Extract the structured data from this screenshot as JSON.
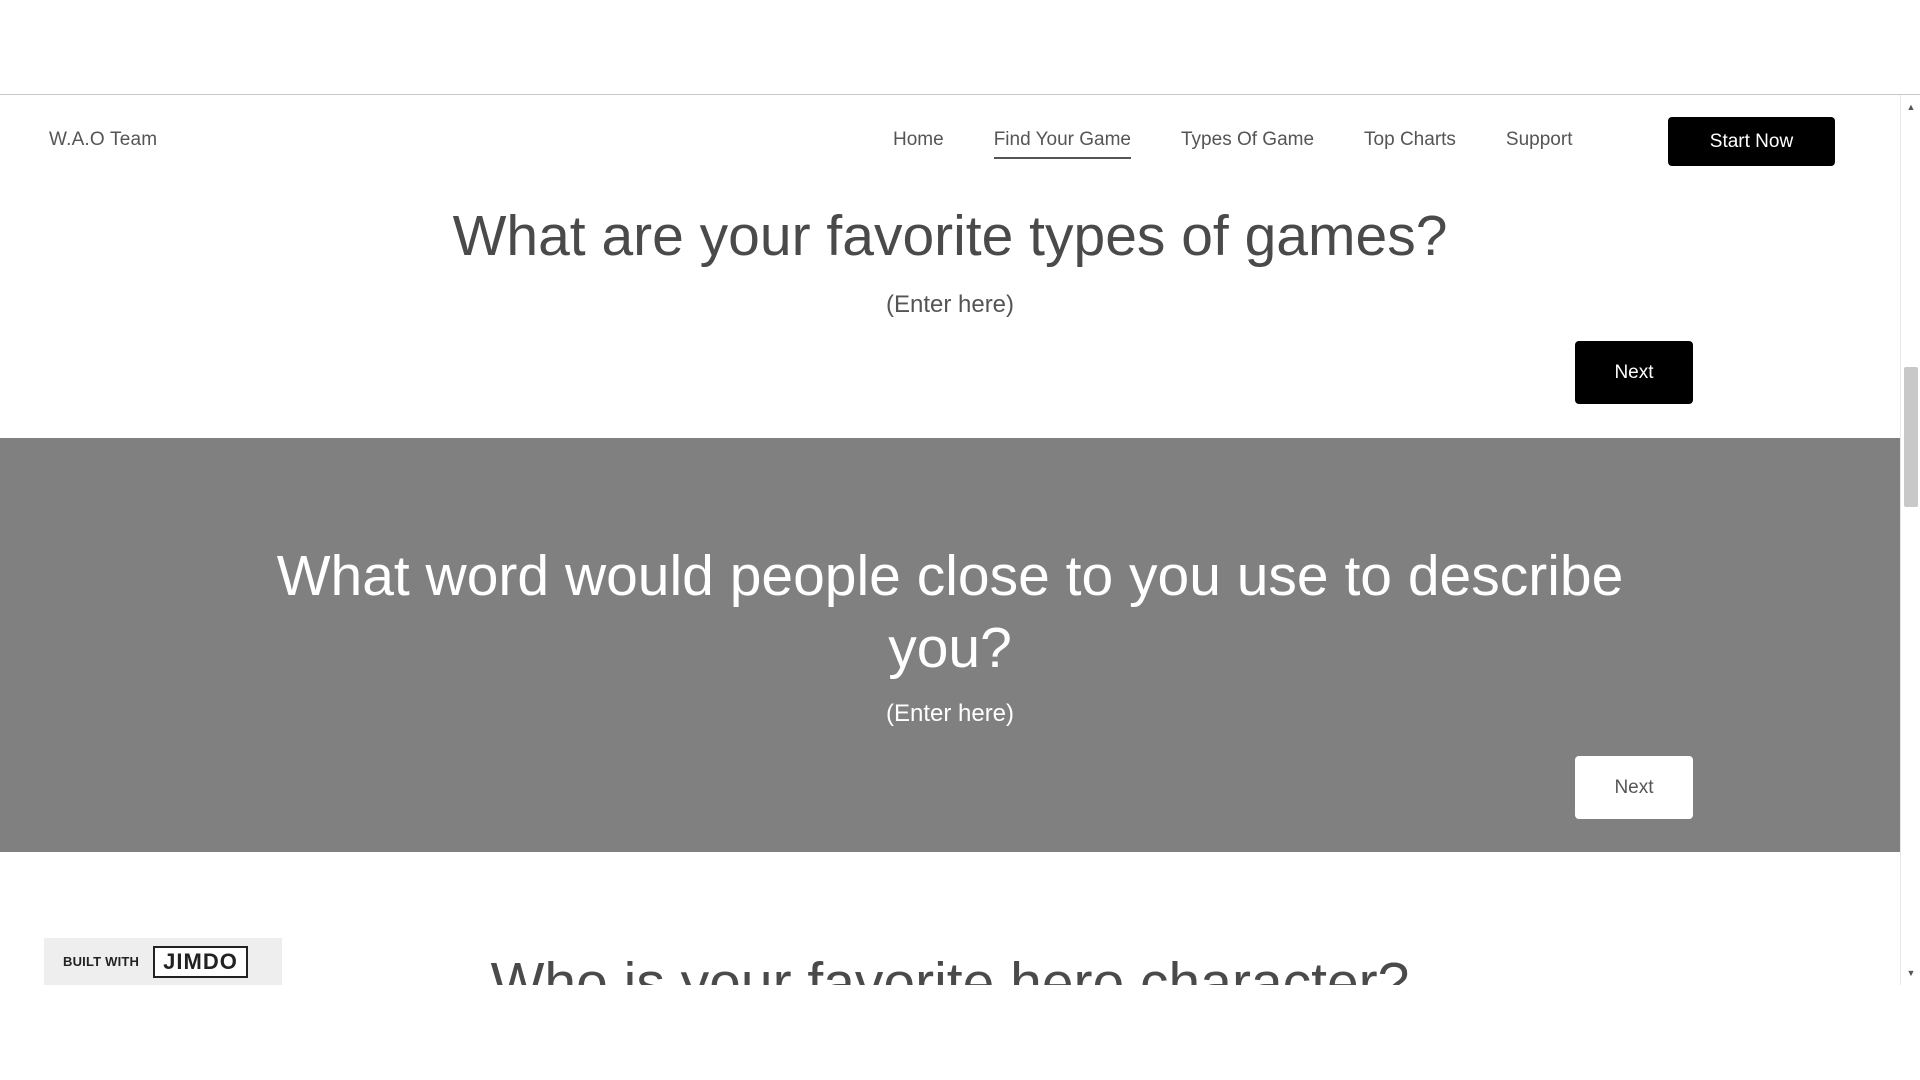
{
  "header": {
    "logo": "W.A.O Team",
    "nav": [
      "Home",
      "Find Your Game",
      "Types Of Game",
      "Top Charts",
      "Support"
    ],
    "active_nav": "Find Your Game",
    "cta_label": "Start Now"
  },
  "sections": [
    {
      "question": "What are your favorite types of games?",
      "hint": "(Enter here)",
      "button_label": "Next"
    },
    {
      "question": "What word would people close to you use to describe you?",
      "hint": "(Enter here)",
      "button_label": "Next"
    },
    {
      "question": "Who is your favorite hero character?"
    }
  ],
  "badge": {
    "built_with": "BUILT WITH",
    "brand": "JIMDO"
  },
  "scrollbar": {
    "up_icon": "scroll-up-arrow-icon",
    "down_icon": "scroll-down-arrow-icon"
  }
}
